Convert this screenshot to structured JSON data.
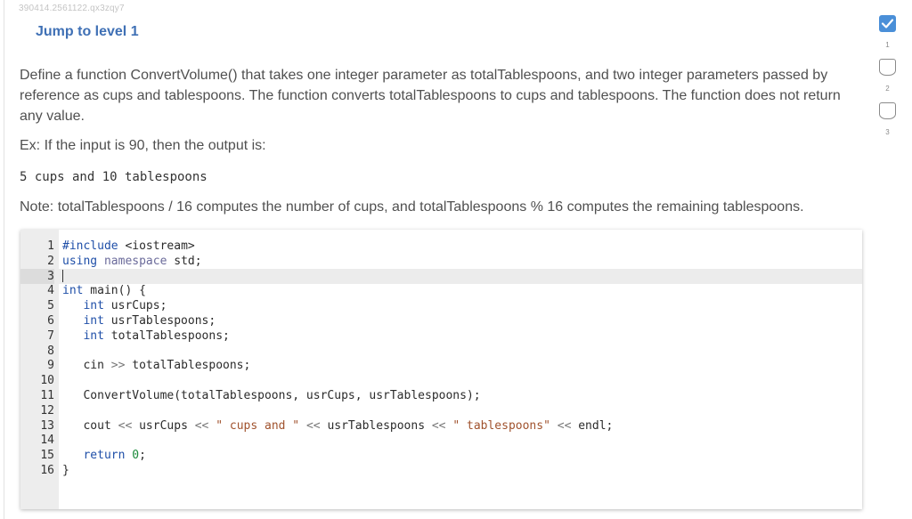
{
  "breadcrumb": "390414.2561122.qx3zqy7",
  "jump_label": "Jump to level 1",
  "description": "Define a function ConvertVolume() that takes one integer parameter as totalTablespoons, and two integer parameters passed by reference as cups and tablespoons. The function converts totalTablespoons to cups and tablespoons. The function does not return any value.",
  "example_text": "Ex: If the input is 90, then the output is:",
  "sample_output": "5 cups and 10 tablespoons",
  "note_text": "Note: totalTablespoons / 16 computes the number of cups, and totalTablespoons % 16 computes the remaining tablespoons.",
  "code": {
    "active_line": 3,
    "lines": [
      {
        "n": "1",
        "tokens": [
          {
            "t": "#include",
            "c": "kw"
          },
          {
            "t": " <iostream>",
            "c": ""
          }
        ]
      },
      {
        "n": "2",
        "tokens": [
          {
            "t": "using",
            "c": "kw"
          },
          {
            "t": " ",
            "c": ""
          },
          {
            "t": "namespace",
            "c": "ns"
          },
          {
            "t": " std;",
            "c": ""
          }
        ]
      },
      {
        "n": "3",
        "tokens": []
      },
      {
        "n": "4",
        "tokens": [
          {
            "t": "int",
            "c": "kw"
          },
          {
            "t": " main() {",
            "c": ""
          }
        ]
      },
      {
        "n": "5",
        "tokens": [
          {
            "t": "   int",
            "c": "kw"
          },
          {
            "t": " usrCups;",
            "c": ""
          }
        ]
      },
      {
        "n": "6",
        "tokens": [
          {
            "t": "   int",
            "c": "kw"
          },
          {
            "t": " usrTablespoons;",
            "c": ""
          }
        ]
      },
      {
        "n": "7",
        "tokens": [
          {
            "t": "   int",
            "c": "kw"
          },
          {
            "t": " totalTablespoons;",
            "c": ""
          }
        ]
      },
      {
        "n": "8",
        "tokens": []
      },
      {
        "n": "9",
        "tokens": [
          {
            "t": "   cin ",
            "c": ""
          },
          {
            "t": ">>",
            "c": "op"
          },
          {
            "t": " totalTablespoons;",
            "c": ""
          }
        ]
      },
      {
        "n": "10",
        "tokens": []
      },
      {
        "n": "11",
        "tokens": [
          {
            "t": "   ConvertVolume(totalTablespoons, usrCups, usrTablespoons);",
            "c": ""
          }
        ]
      },
      {
        "n": "12",
        "tokens": []
      },
      {
        "n": "13",
        "tokens": [
          {
            "t": "   cout ",
            "c": ""
          },
          {
            "t": "<<",
            "c": "op"
          },
          {
            "t": " usrCups ",
            "c": ""
          },
          {
            "t": "<<",
            "c": "op"
          },
          {
            "t": " \" cups and \"",
            "c": "str"
          },
          {
            "t": " ",
            "c": ""
          },
          {
            "t": "<<",
            "c": "op"
          },
          {
            "t": " usrTablespoons ",
            "c": ""
          },
          {
            "t": "<<",
            "c": "op"
          },
          {
            "t": " \" tablespoons\"",
            "c": "str"
          },
          {
            "t": " ",
            "c": ""
          },
          {
            "t": "<<",
            "c": "op"
          },
          {
            "t": " endl;",
            "c": ""
          }
        ]
      },
      {
        "n": "14",
        "tokens": []
      },
      {
        "n": "15",
        "tokens": [
          {
            "t": "   return",
            "c": "kw"
          },
          {
            "t": " ",
            "c": ""
          },
          {
            "t": "0",
            "c": "num"
          },
          {
            "t": ";",
            "c": ""
          }
        ]
      },
      {
        "n": "16",
        "tokens": [
          {
            "t": "}",
            "c": ""
          }
        ]
      }
    ]
  },
  "levels": [
    {
      "label": "1",
      "state": "done",
      "icon": "check-icon"
    },
    {
      "label": "2",
      "state": "todo",
      "icon": "level-badge-icon"
    },
    {
      "label": "3",
      "state": "todo",
      "icon": "level-badge-icon"
    }
  ],
  "colors": {
    "accent": "#3f70b5",
    "check": "#4a8fd8"
  }
}
